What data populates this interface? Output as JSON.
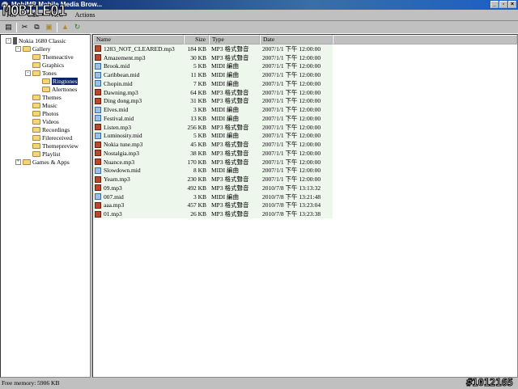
{
  "window": {
    "title": "MobiMB Mobile Media Brow..."
  },
  "watermark": {
    "logo": "MOBILE01",
    "id": "#1012165"
  },
  "menu": [
    "File",
    "Edit",
    "View",
    "Actions"
  ],
  "tree": [
    {
      "label": "Nokia 1680 Classic",
      "level": 0,
      "exp": "-"
    },
    {
      "label": "Gallery",
      "level": 1,
      "exp": "-"
    },
    {
      "label": "Themeactive",
      "level": 2
    },
    {
      "label": "Graphics",
      "level": 2
    },
    {
      "label": "Tones",
      "level": 2,
      "exp": "-"
    },
    {
      "label": "Ringtones",
      "level": 3,
      "selected": true
    },
    {
      "label": "Alerttones",
      "level": 3
    },
    {
      "label": "Themes",
      "level": 2
    },
    {
      "label": "Music",
      "level": 2
    },
    {
      "label": "Photos",
      "level": 2
    },
    {
      "label": "Videos",
      "level": 2
    },
    {
      "label": "Recordings",
      "level": 2
    },
    {
      "label": "Filereceived",
      "level": 2
    },
    {
      "label": "Themepreview",
      "level": 2
    },
    {
      "label": "Playlist",
      "level": 2
    },
    {
      "label": "Games & Apps",
      "level": 1,
      "exp": "+"
    }
  ],
  "columns": [
    "Name",
    "Size",
    "Type",
    "Date"
  ],
  "files": [
    [
      "1283_NOT_CLEARED.mp3",
      "184 KB",
      "MP3 格式聲音",
      "2007/1/1 下午 12:00:00",
      "mp3"
    ],
    [
      "Amazement.mp3",
      "30 KB",
      "MP3 格式聲音",
      "2007/1/1 下午 12:00:00",
      "mp3"
    ],
    [
      "Brook.mid",
      "5 KB",
      "MIDI 編曲",
      "2007/1/1 下午 12:00:00",
      "mid"
    ],
    [
      "Caribbean.mid",
      "11 KB",
      "MIDI 編曲",
      "2007/1/1 下午 12:00:00",
      "mid"
    ],
    [
      "Chopin.mid",
      "7 KB",
      "MIDI 編曲",
      "2007/1/1 下午 12:00:00",
      "mid"
    ],
    [
      "Dawning.mp3",
      "64 KB",
      "MP3 格式聲音",
      "2007/1/1 下午 12:00:00",
      "mp3"
    ],
    [
      "Ding dong.mp3",
      "31 KB",
      "MP3 格式聲音",
      "2007/1/1 下午 12:00:00",
      "mp3"
    ],
    [
      "Elves.mid",
      "3 KB",
      "MIDI 編曲",
      "2007/1/1 下午 12:00:00",
      "mid"
    ],
    [
      "Festival.mid",
      "13 KB",
      "MIDI 編曲",
      "2007/1/1 下午 12:00:00",
      "mid"
    ],
    [
      "Listen.mp3",
      "256 KB",
      "MP3 格式聲音",
      "2007/1/1 下午 12:00:00",
      "mp3"
    ],
    [
      "Luminosity.mid",
      "5 KB",
      "MIDI 編曲",
      "2007/1/1 下午 12:00:00",
      "mid"
    ],
    [
      "Nokia tune.mp3",
      "45 KB",
      "MP3 格式聲音",
      "2007/1/1 下午 12:00:00",
      "mp3"
    ],
    [
      "Nostalgia.mp3",
      "38 KB",
      "MP3 格式聲音",
      "2007/1/1 下午 12:00:00",
      "mp3"
    ],
    [
      "Nuance.mp3",
      "170 KB",
      "MP3 格式聲音",
      "2007/1/1 下午 12:00:00",
      "mp3"
    ],
    [
      "Slowdown.mid",
      "8 KB",
      "MIDI 編曲",
      "2007/1/1 下午 12:00:00",
      "mid"
    ],
    [
      "Yearn.mp3",
      "230 KB",
      "MP3 格式聲音",
      "2007/1/1 下午 12:00:00",
      "mp3"
    ],
    [
      "09.mp3",
      "492 KB",
      "MP3 格式聲音",
      "2010/7/8 下午 13:13:32",
      "mp3"
    ],
    [
      "007.mid",
      "3 KB",
      "MIDI 編曲",
      "2010/7/8 下午 13:21:48",
      "mid"
    ],
    [
      "aaa.mp3",
      "457 KB",
      "MP3 格式聲音",
      "2010/7/8 下午 13:23:04",
      "mp3"
    ],
    [
      "01.mp3",
      "26 KB",
      "MP3 格式聲音",
      "2010/7/8 下午 13:23:38",
      "mp3"
    ]
  ],
  "status": {
    "free_memory": "Free memory: 5906 KB"
  }
}
